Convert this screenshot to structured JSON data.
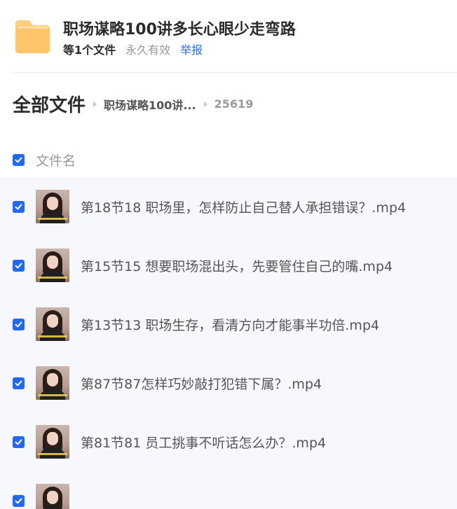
{
  "share": {
    "title": "职场谋略100讲多长心眼少走弯路",
    "file_count": "等1个文件",
    "validity": "永久有效",
    "report_label": "举报"
  },
  "breadcrumb": {
    "root": "全部文件",
    "folder": "职场谋略100讲...",
    "current": "25619"
  },
  "list_header": {
    "column_label": "文件名"
  },
  "files": [
    {
      "name": "第18节18 职场里，怎样防止自己替人承担错误？.mp4",
      "checked": true
    },
    {
      "name": "第15节15 想要职场混出头，先要管住自己的嘴.mp4",
      "checked": true
    },
    {
      "name": "第13节13 职场生存，看清方向才能事半功倍.mp4",
      "checked": true
    },
    {
      "name": "第87节87怎样巧妙敲打犯错下属？.mp4",
      "checked": true
    },
    {
      "name": "第81节81 员工挑事不听话怎么办？.mp4",
      "checked": true
    }
  ],
  "colors": {
    "accent": "#2468f2",
    "link": "#2f6fe4",
    "folder": "#ffc66b",
    "list_bg": "#f7f8fd"
  }
}
